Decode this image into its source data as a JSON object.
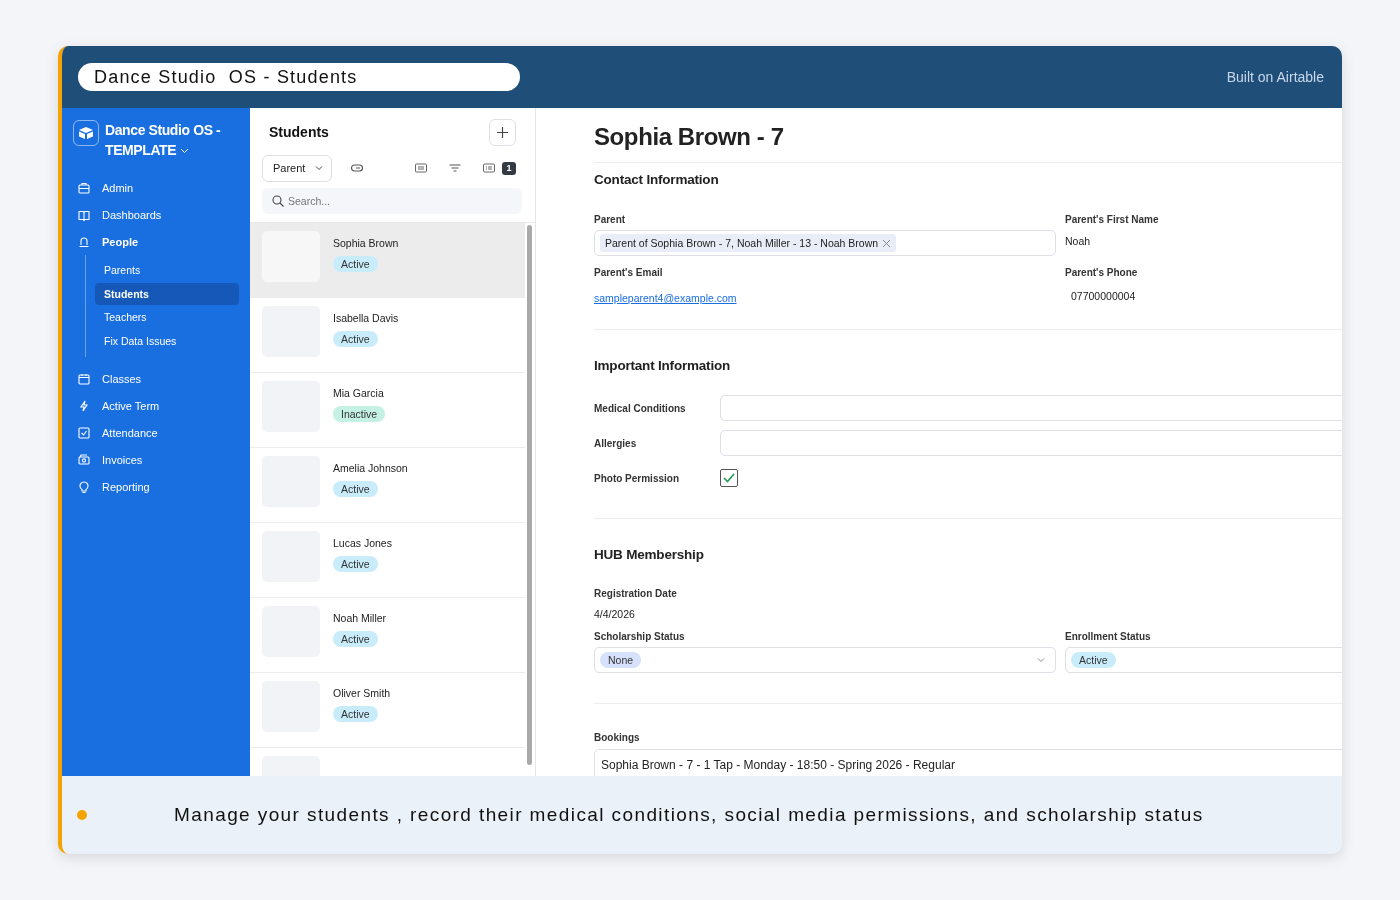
{
  "window": {
    "title": "Dance Studio  OS - Students",
    "built_on": "Built on Airtable"
  },
  "sidebar": {
    "workspace": "Dance Studio OS - TEMPLATE",
    "items": [
      {
        "label": "Admin",
        "selected": false
      },
      {
        "label": "Dashboards",
        "selected": false
      },
      {
        "label": "People",
        "selected": false,
        "expanded": true,
        "children": [
          {
            "label": "Parents",
            "selected": false
          },
          {
            "label": "Students",
            "selected": true
          },
          {
            "label": "Teachers",
            "selected": false
          },
          {
            "label": "Fix Data Issues",
            "selected": false
          }
        ]
      },
      {
        "label": "Classes",
        "selected": false
      },
      {
        "label": "Active Term",
        "selected": false
      },
      {
        "label": "Attendance",
        "selected": false
      },
      {
        "label": "Invoices",
        "selected": false
      },
      {
        "label": "Reporting",
        "selected": false
      }
    ]
  },
  "list": {
    "title": "Students",
    "group_by": "Parent",
    "sort_count": "1",
    "search": {
      "placeholder": "Search..."
    },
    "records": [
      {
        "name": "Sophia Brown",
        "status": "Active",
        "color": "#c9ecfb",
        "selected": true
      },
      {
        "name": "Isabella Davis",
        "status": "Active",
        "color": "#c9ecfb",
        "selected": false
      },
      {
        "name": "Mia Garcia",
        "status": "Inactive",
        "color": "#c4f1e4",
        "selected": false
      },
      {
        "name": "Amelia Johnson",
        "status": "Active",
        "color": "#c9ecfb",
        "selected": false
      },
      {
        "name": "Lucas Jones",
        "status": "Active",
        "color": "#c9ecfb",
        "selected": false
      },
      {
        "name": "Noah Miller",
        "status": "Active",
        "color": "#c9ecfb",
        "selected": false
      },
      {
        "name": "Oliver Smith",
        "status": "Active",
        "color": "#c9ecfb",
        "selected": false
      }
    ]
  },
  "detail": {
    "title": "Sophia Brown - 7",
    "contact": {
      "heading": "Contact Information",
      "parent_label": "Parent",
      "parent_value": "Parent of Sophia Brown - 7, Noah Miller - 13 - Noah Brown",
      "first_name_label": "Parent's First Name",
      "first_name": "Noah",
      "email_label": "Parent's Email",
      "email": "sampleparent4@example.com",
      "phone_label": "Parent's Phone",
      "phone": "07700000004"
    },
    "important": {
      "heading": "Important Information",
      "medical_label": "Medical Conditions",
      "allergies_label": "Allergies",
      "photo_label": "Photo Permission",
      "photo_permission": true
    },
    "hub": {
      "heading": "HUB Membership",
      "registration_label": "Registration Date",
      "registration_date": "4/4/2026",
      "scholarship_label": "Scholarship Status",
      "scholarship": "None",
      "enrollment_label": "Enrollment Status",
      "enrollment": "Active"
    },
    "bookings": {
      "label": "Bookings",
      "value": "Sophia Brown - 7 - 1 Tap - Monday - 18:50 - Spring 2026 - Regular"
    }
  },
  "caption": "Manage your students , record their medical conditions, social media permissions, and scholarship status"
}
